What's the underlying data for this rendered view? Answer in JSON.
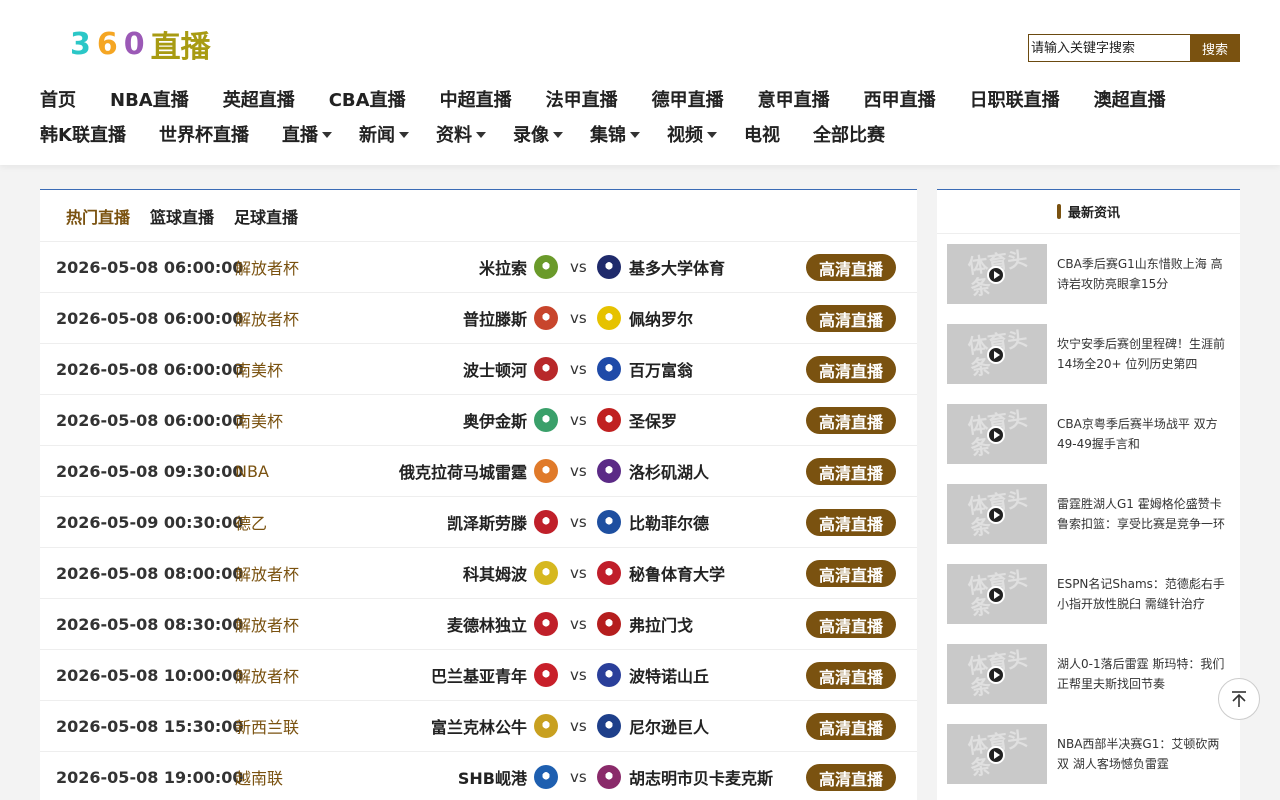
{
  "logo": {
    "p1": "3",
    "p2": "6",
    "p3": "0",
    "p4": "直播"
  },
  "search": {
    "placeholder": "请输入关键字搜索",
    "button": "搜索"
  },
  "nav_row1": [
    "首页",
    "NBA直播",
    "英超直播",
    "CBA直播",
    "中超直播",
    "法甲直播",
    "德甲直播",
    "意甲直播",
    "西甲直播",
    "日职联直播",
    "澳超直播"
  ],
  "nav_row2": [
    {
      "label": "韩K联直播",
      "dropdown": false
    },
    {
      "label": "世界杯直播",
      "dropdown": false
    },
    {
      "label": "直播",
      "dropdown": true
    },
    {
      "label": "新闻",
      "dropdown": true
    },
    {
      "label": "资料",
      "dropdown": true
    },
    {
      "label": "录像",
      "dropdown": true
    },
    {
      "label": "集锦",
      "dropdown": true
    },
    {
      "label": "视频",
      "dropdown": true
    },
    {
      "label": "电视",
      "dropdown": false
    },
    {
      "label": "全部比赛",
      "dropdown": false
    }
  ],
  "tabs": [
    "热门直播",
    "篮球直播",
    "足球直播"
  ],
  "live_button": "高清直播",
  "matches": [
    {
      "time": "2026-05-08 06:00:00",
      "league": "解放者杯",
      "home": "米拉索",
      "away": "基多大学体育",
      "home_color": "#6a9a2a",
      "away_color": "#1f2a6b"
    },
    {
      "time": "2026-05-08 06:00:00",
      "league": "解放者杯",
      "home": "普拉滕斯",
      "away": "佩纳罗尔",
      "home_color": "#c8452c",
      "away_color": "#e6c200"
    },
    {
      "time": "2026-05-08 06:00:00",
      "league": "南美杯",
      "home": "波士顿河",
      "away": "百万富翁",
      "home_color": "#b8282a",
      "away_color": "#1f4aa8"
    },
    {
      "time": "2026-05-08 06:00:00",
      "league": "南美杯",
      "home": "奥伊金斯",
      "away": "圣保罗",
      "home_color": "#3aa06a",
      "away_color": "#c02020"
    },
    {
      "time": "2026-05-08 09:30:00",
      "league": "NBA",
      "home": "俄克拉荷马城雷霆",
      "away": "洛杉矶湖人",
      "home_color": "#e07a2a",
      "away_color": "#5b2a86"
    },
    {
      "time": "2026-05-09 00:30:00",
      "league": "德乙",
      "home": "凯泽斯劳滕",
      "away": "比勒菲尔德",
      "home_color": "#c0202a",
      "away_color": "#1e4fa0"
    },
    {
      "time": "2026-05-08 08:00:00",
      "league": "解放者杯",
      "home": "科其姆波",
      "away": "秘鲁体育大学",
      "home_color": "#d6b820",
      "away_color": "#c01e2a"
    },
    {
      "time": "2026-05-08 08:30:00",
      "league": "解放者杯",
      "home": "麦德林独立",
      "away": "弗拉门戈",
      "home_color": "#c0202a",
      "away_color": "#b51e1e"
    },
    {
      "time": "2026-05-08 10:00:00",
      "league": "解放者杯",
      "home": "巴兰基亚青年",
      "away": "波特诺山丘",
      "home_color": "#c8202a",
      "away_color": "#2a3f9a"
    },
    {
      "time": "2026-05-08 15:30:00",
      "league": "新西兰联",
      "home": "富兰克林公牛",
      "away": "尼尔逊巨人",
      "home_color": "#c8a020",
      "away_color": "#1e3f8a"
    },
    {
      "time": "2026-05-08 19:00:00",
      "league": "越南联",
      "home": "SHB岘港",
      "away": "胡志明市贝卡麦克斯",
      "home_color": "#1e5fb0",
      "away_color": "#8a2a6a"
    }
  ],
  "sidebar": {
    "title": "最新资讯",
    "thumb_text": "体育头条",
    "news": [
      "CBA季后赛G1山东惜败上海 高诗岩攻防亮眼拿15分",
      "坎宁安季后赛创里程碑！生涯前14场全20+ 位列历史第四",
      "CBA京粤季后赛半场战平 双方49-49握手言和",
      "雷霆胜湖人G1 霍姆格伦盛赞卡鲁索扣篮：享受比赛是竞争一环",
      "ESPN名记Shams：范德彪右手小指开放性脱臼 需缝针治疗",
      "湖人0-1落后雷霆 斯玛特：我们正帮里夫斯找回节奏",
      "NBA西部半决赛G1：艾顿砍两双 湖人客场憾负雷霆"
    ]
  }
}
